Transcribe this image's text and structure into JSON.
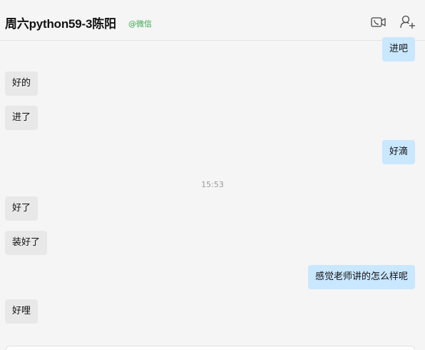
{
  "header": {
    "title": "周六python59-3陈阳",
    "source": "@微信"
  },
  "icons": {
    "minimize": "minimize-icon",
    "maximize": "maximize-icon",
    "close": "close-icon",
    "video": "video-call-icon",
    "add_member": "add-member-icon"
  },
  "messages": {
    "m1": "进吧",
    "m2": "好的",
    "m3": "进了",
    "m4": "好滴",
    "time": "15:53",
    "m5": "好了",
    "m6": "装好了",
    "m7": "感觉老师讲的怎么样呢",
    "m8": "好哩"
  },
  "colors": {
    "incoming_bubble": "#e8e8e8",
    "outgoing_bubble": "#c9e7ff",
    "source_tag": "#39a851",
    "background": "#f5f5f5"
  }
}
